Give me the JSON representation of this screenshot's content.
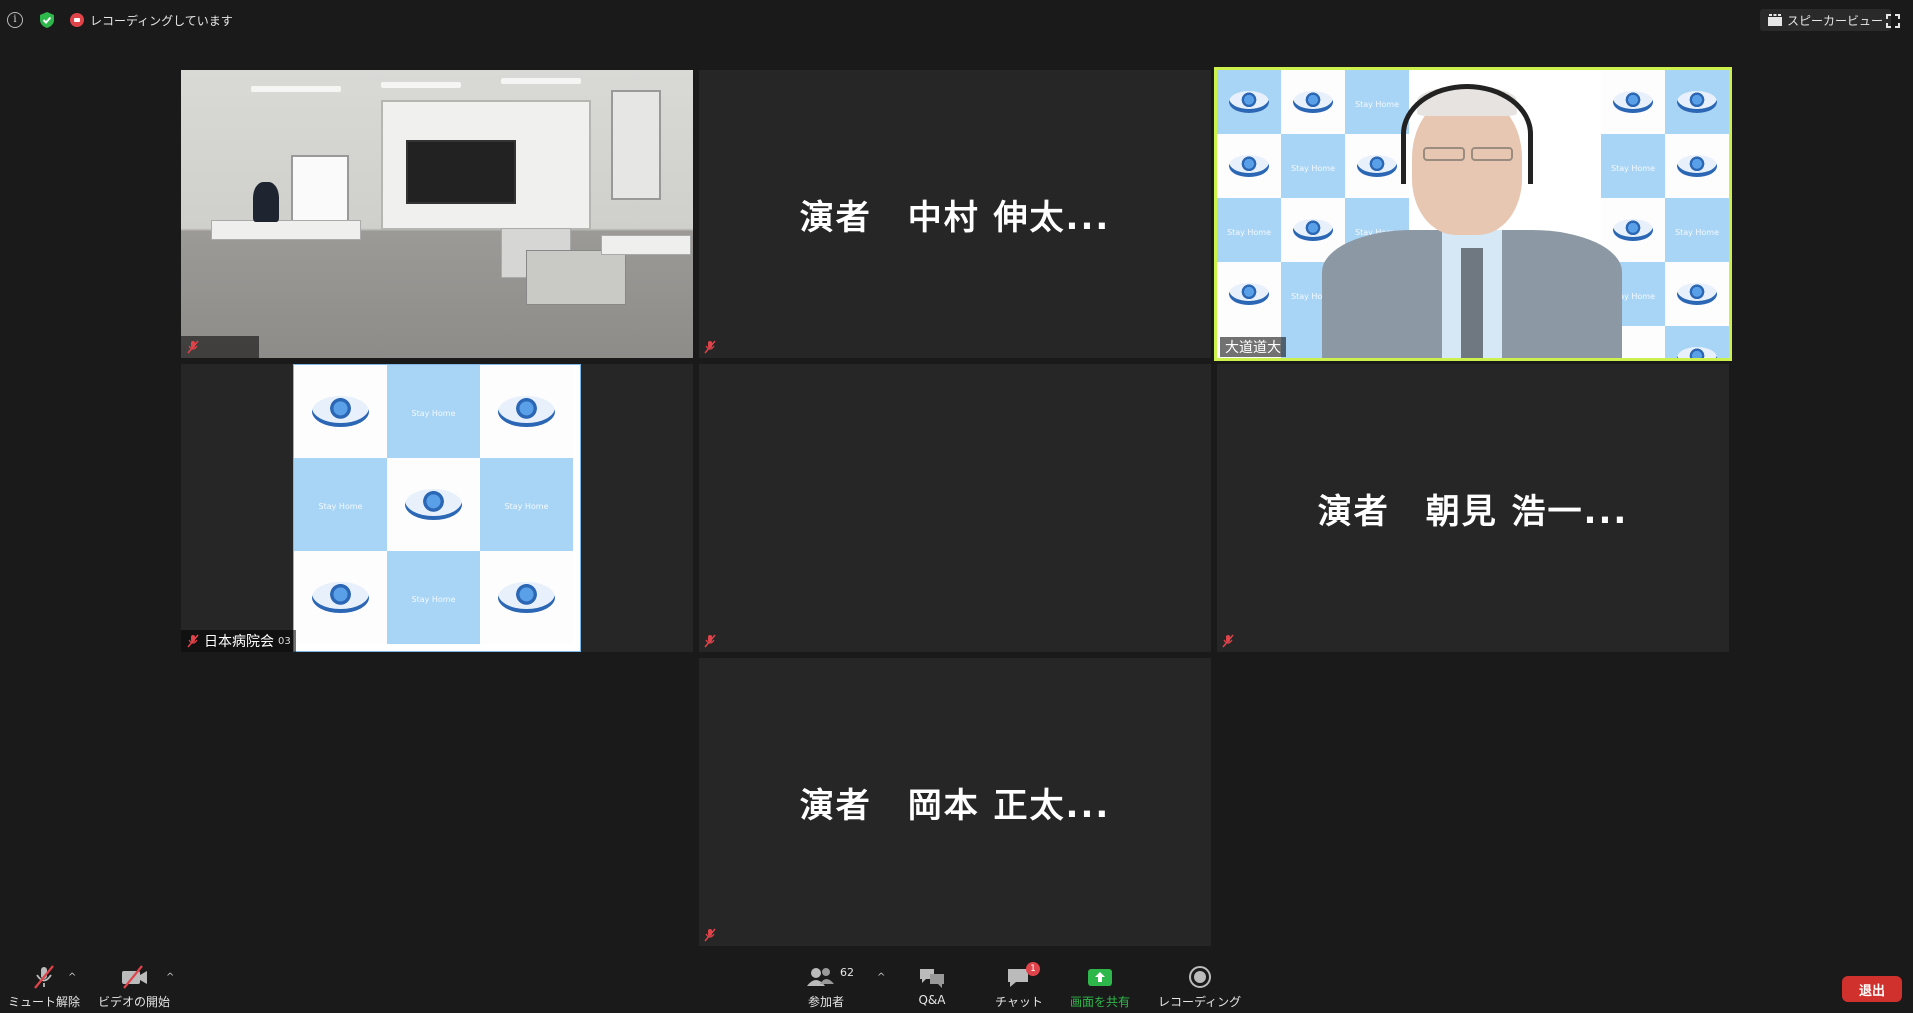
{
  "topbar": {
    "recording_status": "レコーディングしています",
    "view_label": "スピーカービュー"
  },
  "tiles": {
    "room_camera": {
      "name": ""
    },
    "nakamura": {
      "display": "演者　中村 伸太..."
    },
    "speaker": {
      "name": "大道道大"
    },
    "hospital": {
      "name": "日本病院会",
      "suffix": "03"
    },
    "asami": {
      "display": "演者　朝見 浩一..."
    },
    "okamoto": {
      "display": "演者　岡本 正太..."
    }
  },
  "backdrop": {
    "stay_home": "Stay Home"
  },
  "toolbar": {
    "unmute_label": "ミュート解除",
    "start_video_label": "ビデオの開始",
    "participants_label": "参加者",
    "participants_count": "62",
    "qa_label": "Q&A",
    "chat_label": "チャット",
    "chat_badge": "1",
    "share_label": "画面を共有",
    "record_label": "レコーディング",
    "leave_label": "退出"
  },
  "colors": {
    "active_speaker_border": "#ccf04c",
    "share_green": "#2eb84b",
    "leave_red": "#d0312d",
    "recording_red": "#e0444a",
    "muted_red": "#e0444a"
  }
}
